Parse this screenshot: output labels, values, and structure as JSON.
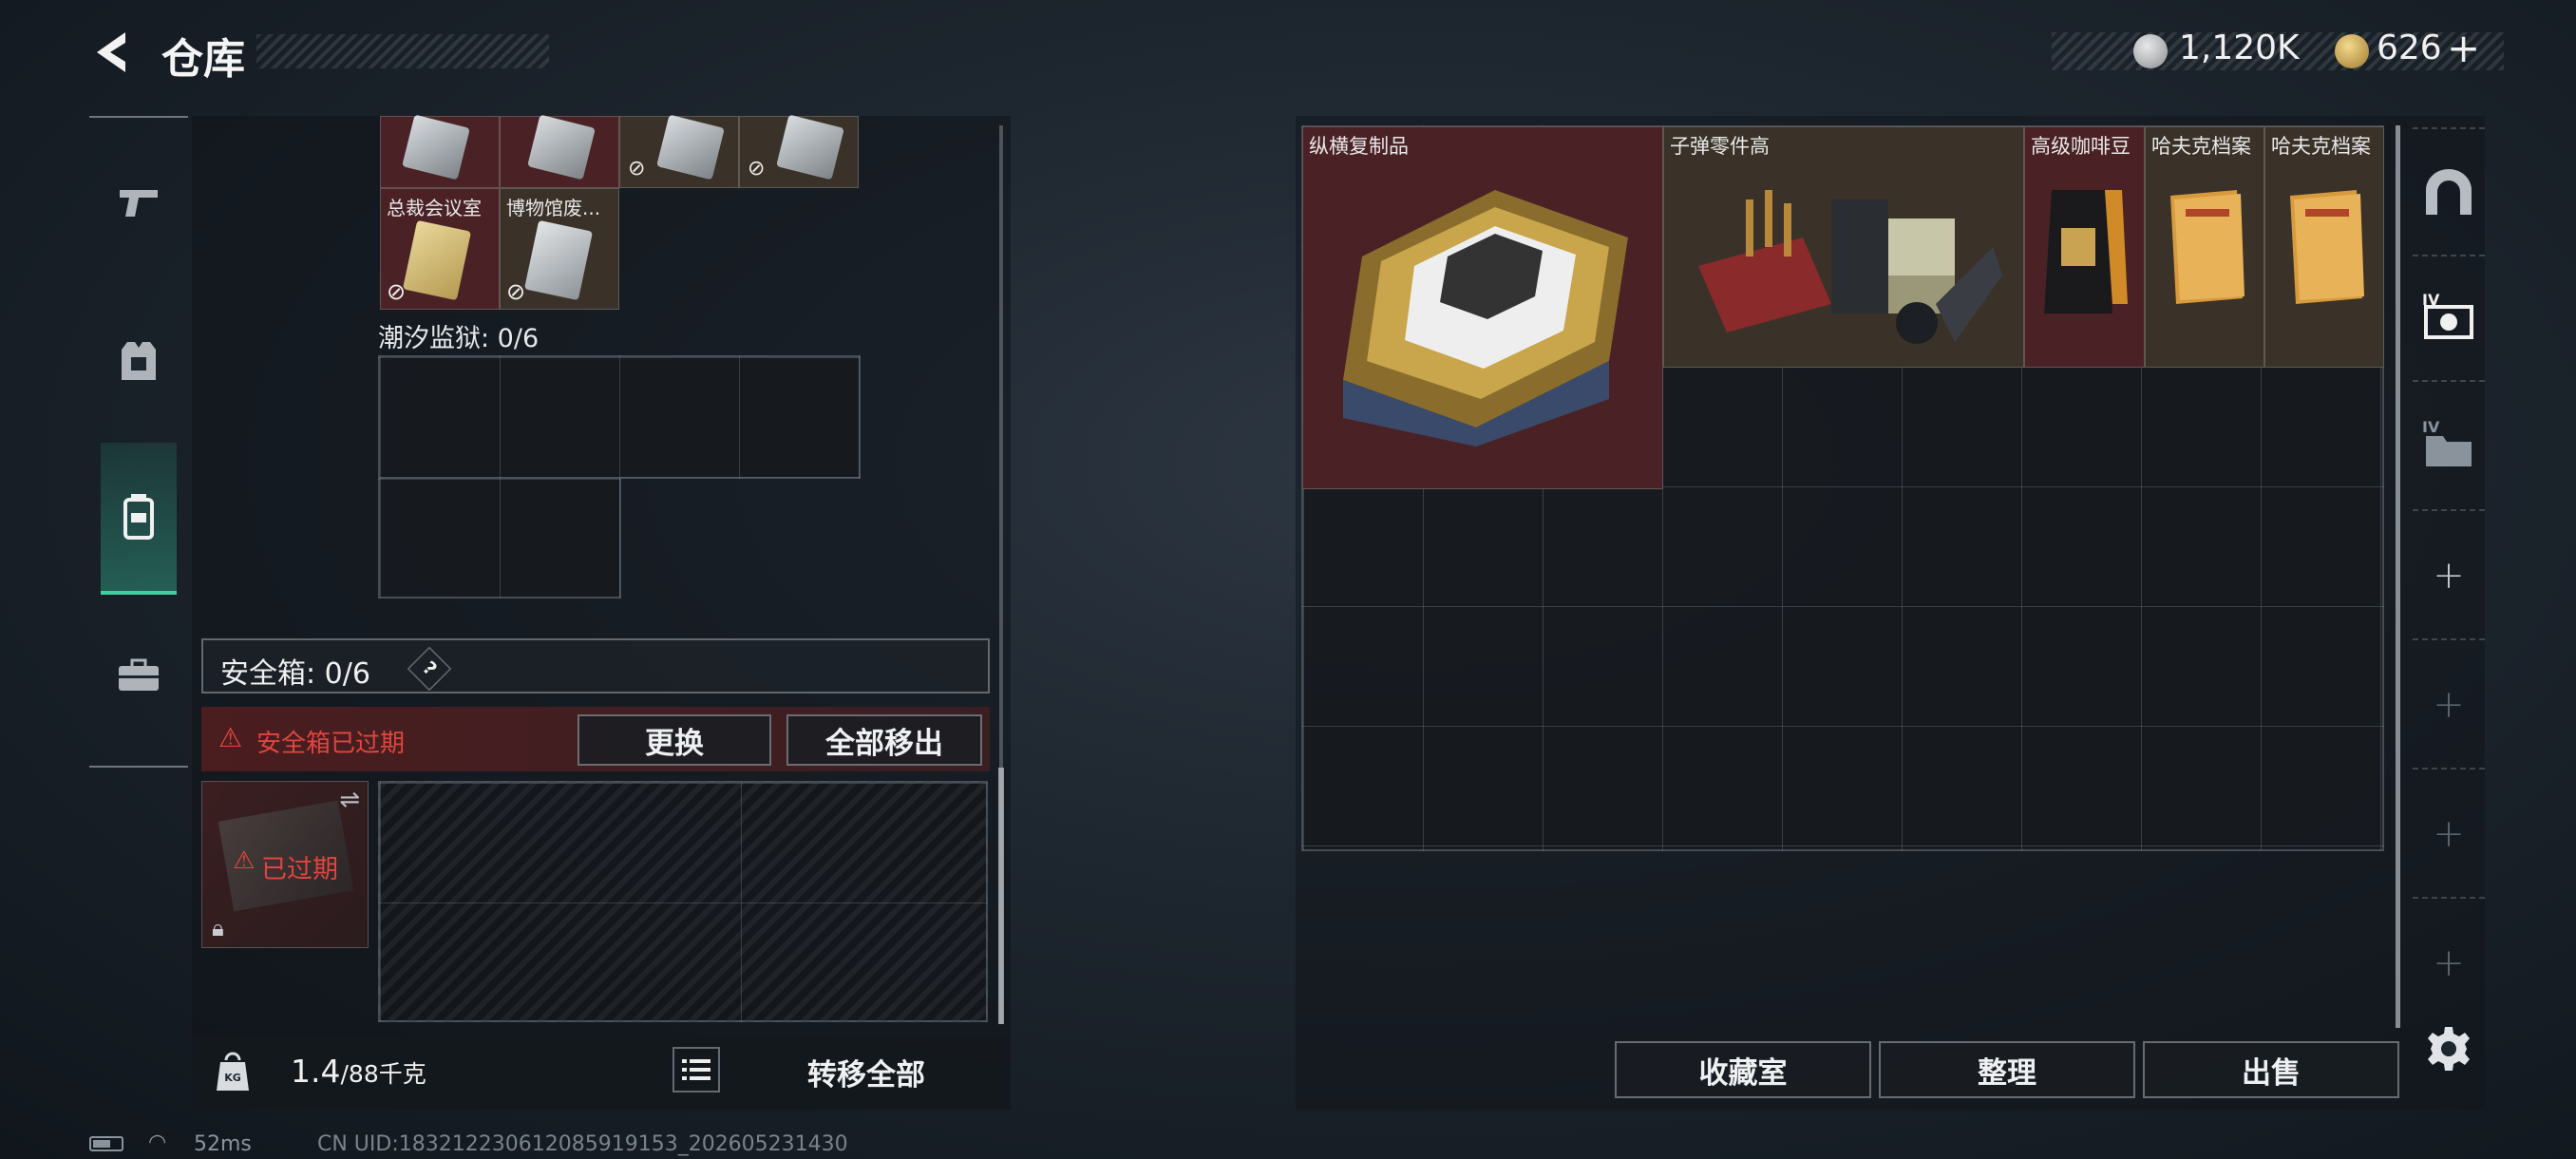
{
  "header": {
    "title": "仓库",
    "currency_silver": "1,120K",
    "currency_gold": "626",
    "currency_plus": "+"
  },
  "left_panel": {
    "top_items": [
      {
        "name": "总裁会议室"
      },
      {
        "name": "博物馆废..."
      }
    ],
    "prison_label": "潮汐监狱: 0/6",
    "safebox": {
      "label": "安全箱: 0/6",
      "help": "?",
      "warning": "安全箱已过期",
      "replace_button": "更换",
      "move_all_out_button": "全部移出",
      "expired_tag": "已过期"
    },
    "footer": {
      "weight": "1.4",
      "weight_max": "/88千克",
      "weight_icon_label": "KG",
      "transfer_all_button": "转移全部"
    }
  },
  "stash": {
    "items": [
      {
        "name": "纵横复制品",
        "color": "#4a2226"
      },
      {
        "name": "子弹零件高",
        "color": "#3a3228"
      },
      {
        "name": "高级咖啡豆",
        "color": "#4a2226"
      },
      {
        "name": "哈夫克档案",
        "color": "#3a3228"
      },
      {
        "name": "哈夫克档案",
        "color": "#3a3228"
      }
    ],
    "buttons": {
      "collection": "收藏室",
      "organize": "整理",
      "sell": "出售"
    }
  },
  "status_bar": {
    "ping": "52ms",
    "uid": "CN UID:183212230612085919153_202605231430"
  },
  "colors": {
    "red_item_bg": "#4a2226",
    "brown_item_bg": "#3a3228",
    "accent_green": "#3fd0a0",
    "warning_red": "#e0453e"
  }
}
